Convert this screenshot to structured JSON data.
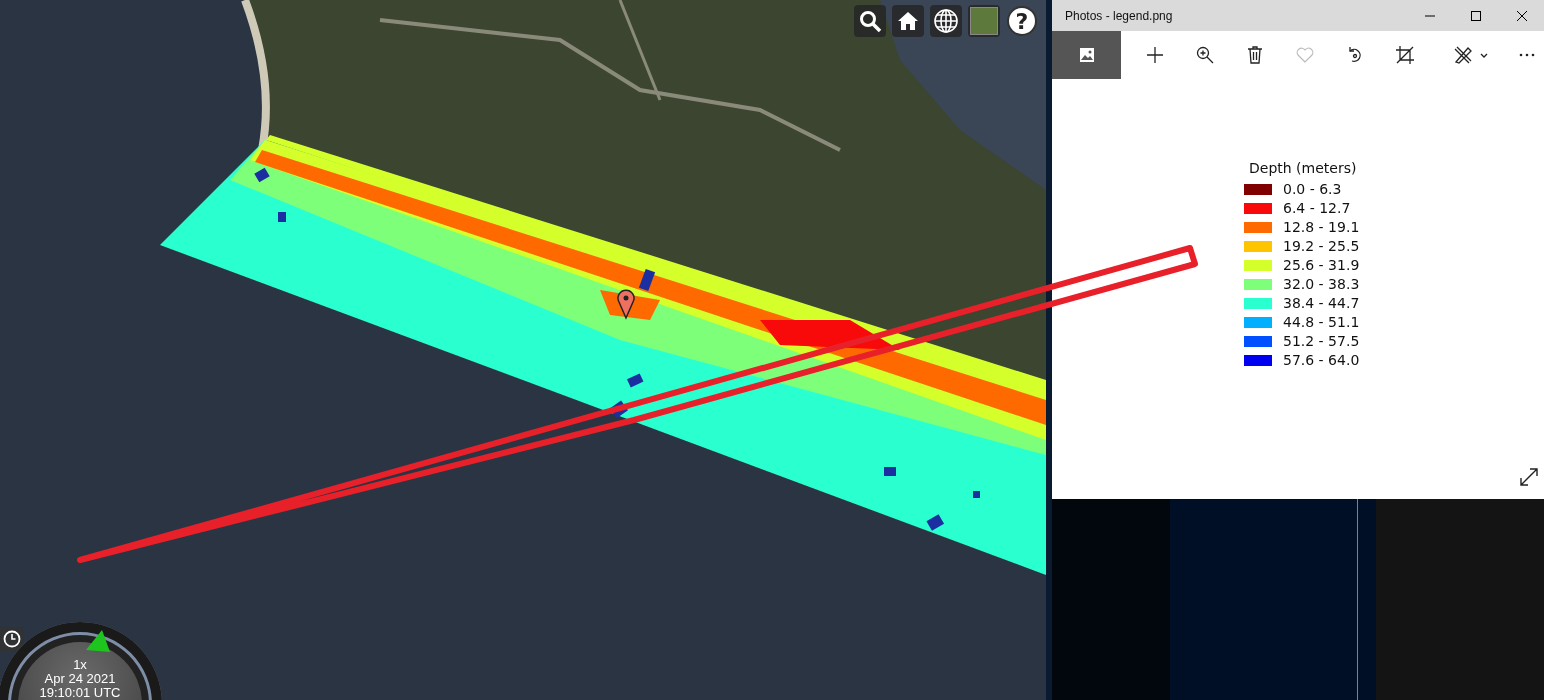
{
  "map": {
    "help_button": {
      "label": "?"
    },
    "clock": {
      "speed": "1x",
      "date": "Apr 24 2021",
      "time": "19:10:01 UTC"
    }
  },
  "photos_window": {
    "title": "Photos - legend.png",
    "toolbar": [
      {
        "kind": "view",
        "selected": true,
        "disabled": false
      },
      {
        "kind": "add",
        "selected": false,
        "disabled": false
      },
      {
        "kind": "zoom",
        "selected": false,
        "disabled": false
      },
      {
        "kind": "delete",
        "selected": false,
        "disabled": false
      },
      {
        "kind": "favorite",
        "selected": false,
        "disabled": true
      },
      {
        "kind": "rotate",
        "selected": false,
        "disabled": false
      },
      {
        "kind": "crop",
        "selected": false,
        "disabled": false
      },
      {
        "kind": "edit",
        "selected": false,
        "disabled": false
      },
      {
        "kind": "more",
        "selected": false,
        "disabled": false
      }
    ],
    "legend": {
      "title": "Depth (meters)",
      "items": [
        {
          "label": "0.0 - 6.3",
          "color": "#800000"
        },
        {
          "label": "6.4 - 12.7",
          "color": "#f80a0a"
        },
        {
          "label": "12.8 - 19.1",
          "color": "#ff6a00"
        },
        {
          "label": "19.2 - 25.5",
          "color": "#ffc400"
        },
        {
          "label": "25.6 - 31.9",
          "color": "#d4ff2a"
        },
        {
          "label": "32.0 - 38.3",
          "color": "#7dff7a"
        },
        {
          "label": "38.4 - 44.7",
          "color": "#2affd0"
        },
        {
          "label": "44.8 - 51.1",
          "color": "#00b0ff"
        },
        {
          "label": "51.2 - 57.5",
          "color": "#0050ff"
        },
        {
          "label": "57.6 - 64.0",
          "color": "#0000f0"
        }
      ]
    }
  }
}
